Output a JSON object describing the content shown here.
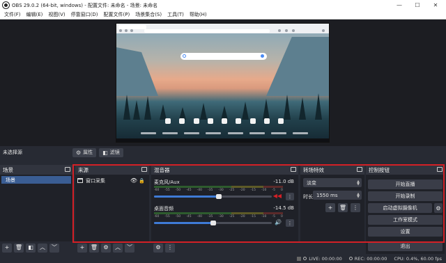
{
  "window": {
    "title": "OBS 29.0.2 (64-bit, windows) - 配置文件: 未命名 - 场景: 未命名",
    "minimize": "—",
    "maximize": "☐",
    "close": "✕"
  },
  "menu": [
    "文件(F)",
    "编辑(E)",
    "视图(V)",
    "停靠窗口(D)",
    "配置文件(P)",
    "场景集合(S)",
    "工具(T)",
    "帮助(H)"
  ],
  "context_bar": {
    "no_selection": "未选择源",
    "properties_label": "属性",
    "filters_label": "滤镜"
  },
  "scenes": {
    "header": "场景",
    "items": [
      "场景"
    ]
  },
  "sources": {
    "header": "来源",
    "items": [
      "窗口采集"
    ]
  },
  "mixer": {
    "header": "混音器",
    "channels": [
      {
        "name": "麦克风/Aux",
        "db": "-11.0 dB",
        "volume_fraction": 0.55,
        "muted": true
      },
      {
        "name": "桌面音频",
        "db": "-14.5 dB",
        "volume_fraction": 0.5,
        "muted": false
      }
    ],
    "scale_labels": [
      "-60",
      "-55",
      "-50",
      "-45",
      "-40",
      "-35",
      "-30",
      "-25",
      "-20",
      "-15",
      "-10",
      "-5",
      "0"
    ]
  },
  "transitions": {
    "header": "转场特效",
    "selected": "淡变",
    "duration_label": "时长",
    "duration_value": "1550 ms"
  },
  "controls": {
    "header": "控制按钮",
    "start_streaming": "开始直播",
    "start_recording": "开始录制",
    "start_virtual_camera": "启动虚拟摄像机",
    "studio_mode": "工作室模式",
    "settings": "设置",
    "exit": "退出"
  },
  "status": {
    "live": "LIVE: 00:00:00",
    "rec": "REC: 00:00:00",
    "cpu": "CPU: 0.4%, 60.00 fps"
  },
  "colors": {
    "highlight": "#d42026",
    "accent": "#3f7bd6",
    "mute_red": "#d42026"
  }
}
